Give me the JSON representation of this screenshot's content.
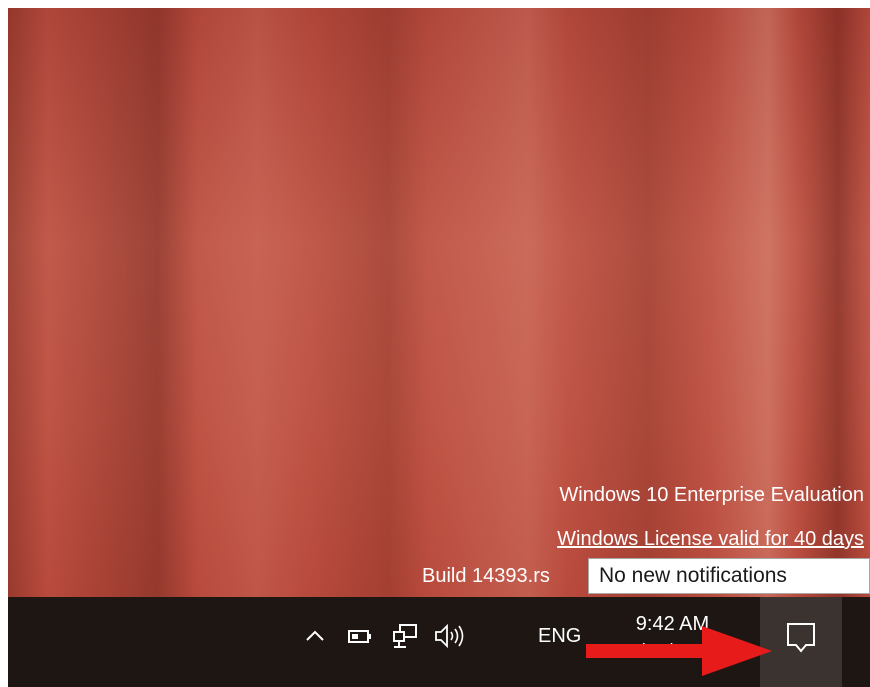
{
  "desktop": {
    "watermark": {
      "edition": "Windows 10 Enterprise Evaluation",
      "license": "Windows License valid for 40 days",
      "build": "Build 14393.rs"
    }
  },
  "tooltip": {
    "text": "No new notifications"
  },
  "taskbar": {
    "language": "ENG",
    "clock": {
      "time": "9:42 AM",
      "date": "5/31/2017"
    },
    "tray_icons": [
      "show-hidden-icons-chevron",
      "battery-icon",
      "network-icon",
      "volume-icon"
    ],
    "action_center_icon": "notification-icon"
  },
  "annotation": {
    "arrow_color": "#e81b1b"
  },
  "colors": {
    "taskbar": "#1e1613",
    "action_button": "#3a3330",
    "desktop": "#bf5445"
  }
}
